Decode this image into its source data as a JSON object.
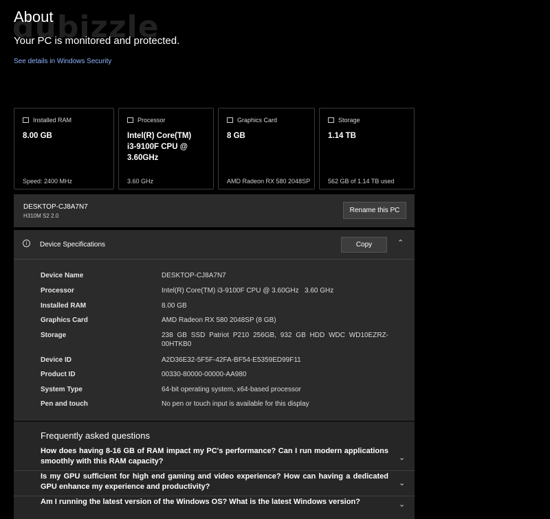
{
  "watermark": "dubizzle",
  "header": {
    "title": "About",
    "subtitle": "Your PC is monitored and protected.",
    "security_link": "See details in Windows Security"
  },
  "cards": [
    {
      "label": "Installed RAM",
      "value": "8.00 GB",
      "footer": "Speed: 2400 MHz",
      "icon": "ram-icon"
    },
    {
      "label": "Processor",
      "value": "Intel(R) Core(TM) i3-9100F CPU @ 3.60GHz",
      "footer": "3.60 GHz",
      "icon": "processor-icon"
    },
    {
      "label": "Graphics Card",
      "value": "8 GB",
      "footer": "AMD Radeon RX 580 2048SP",
      "icon": "graphics-card-icon"
    },
    {
      "label": "Storage",
      "value": "1.14 TB",
      "footer": "562 GB of 1.14 TB used",
      "icon": "storage-icon"
    }
  ],
  "pc": {
    "name": "DESKTOP-CJ8A7N7",
    "model": "H310M S2 2.0",
    "rename_label": "Rename this PC"
  },
  "specs": {
    "title": "Device Specifications",
    "copy_label": "Copy",
    "rows": [
      {
        "label": "Device Name",
        "value": "DESKTOP-CJ8A7N7"
      },
      {
        "label": "Processor",
        "value": "Intel(R) Core(TM) i3-9100F CPU @ 3.60GHz   3.60 GHz"
      },
      {
        "label": "Installed RAM",
        "value": "8.00 GB"
      },
      {
        "label": "Graphics Card",
        "value": "AMD Radeon RX 580 2048SP (8 GB)"
      },
      {
        "label": "Storage",
        "value": "238 GB SSD Patriot P210 256GB, 932 GB HDD WDC WD10EZRZ-00HTKB0"
      },
      {
        "label": "Device ID",
        "value": "A2D36E32-5F5F-42FA-BF54-E5359ED99F11"
      },
      {
        "label": "Product ID",
        "value": "00330-80000-00000-AA980"
      },
      {
        "label": "System Type",
        "value": "64-bit operating system, x64-based processor"
      },
      {
        "label": "Pen and touch",
        "value": "No pen or touch input is available for this display"
      }
    ]
  },
  "faq": {
    "title": "Frequently asked questions",
    "questions": [
      "How does having 8-16 GB of RAM impact my PC's performance? Can I run modern applications smoothly with this RAM capacity?",
      "Is my GPU sufficient for high end gaming and video experience? How can having a dedicated GPU enhance my experience and productivity?",
      "Am I running the latest version of the Windows OS? What is the latest Windows version?"
    ]
  }
}
